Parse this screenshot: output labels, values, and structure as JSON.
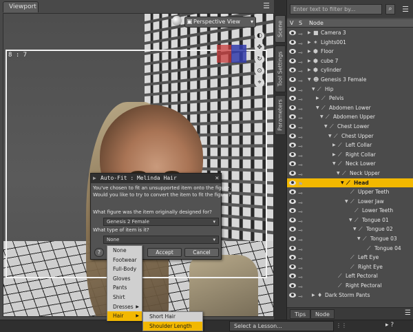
{
  "viewport": {
    "tab_label": "Viewport",
    "view_select": "Perspective View",
    "aspect_label": "8 : 7"
  },
  "side_tabs": [
    "Scene",
    "Tool Settings",
    "Parameters"
  ],
  "scene_pane": {
    "filter_placeholder": "Enter text to filter by...",
    "columns": {
      "visible": "V",
      "selectable": "S",
      "node": "Node"
    },
    "nodes": [
      {
        "label": "Camera 3",
        "depth": 0,
        "icon": "camera-icon"
      },
      {
        "label": "Lights001",
        "depth": 0,
        "icon": "lights-icon"
      },
      {
        "label": "Floor",
        "depth": 0,
        "icon": "prop-icon"
      },
      {
        "label": "cube 7",
        "depth": 0,
        "icon": "prop-icon"
      },
      {
        "label": "cylinder",
        "depth": 0,
        "icon": "prop-icon"
      },
      {
        "label": "Genesis 3 Female",
        "depth": 0,
        "icon": "figure-icon"
      },
      {
        "label": "Hip",
        "depth": 1,
        "icon": "bone-icon"
      },
      {
        "label": "Pelvis",
        "depth": 2,
        "icon": "bone-icon"
      },
      {
        "label": "Abdomen Lower",
        "depth": 2,
        "icon": "bone-icon"
      },
      {
        "label": "Abdomen Upper",
        "depth": 3,
        "icon": "bone-icon"
      },
      {
        "label": "Chest Lower",
        "depth": 4,
        "icon": "bone-icon"
      },
      {
        "label": "Chest Upper",
        "depth": 5,
        "icon": "bone-icon"
      },
      {
        "label": "Left Collar",
        "depth": 6,
        "icon": "bone-icon"
      },
      {
        "label": "Right Collar",
        "depth": 6,
        "icon": "bone-icon"
      },
      {
        "label": "Neck Lower",
        "depth": 6,
        "icon": "bone-icon"
      },
      {
        "label": "Neck Upper",
        "depth": 7,
        "icon": "bone-icon"
      },
      {
        "label": "Head",
        "depth": 8,
        "icon": "bone-icon",
        "selected": true
      },
      {
        "label": "Upper Teeth",
        "depth": 9,
        "icon": "bone-icon"
      },
      {
        "label": "Lower Jaw",
        "depth": 9,
        "icon": "bone-icon"
      },
      {
        "label": "Lower Teeth",
        "depth": 10,
        "icon": "bone-icon"
      },
      {
        "label": "Tongue 01",
        "depth": 10,
        "icon": "bone-icon"
      },
      {
        "label": "Tongue 02",
        "depth": 11,
        "icon": "bone-icon"
      },
      {
        "label": "Tongue 03",
        "depth": 12,
        "icon": "bone-icon"
      },
      {
        "label": "Tongue 04",
        "depth": 13,
        "icon": "bone-icon"
      },
      {
        "label": "Left Eye",
        "depth": 9,
        "icon": "bone-icon"
      },
      {
        "label": "Right Eye",
        "depth": 9,
        "icon": "bone-icon"
      },
      {
        "label": "Left Pectoral",
        "depth": 6,
        "icon": "bone-icon"
      },
      {
        "label": "Right Pectoral",
        "depth": 6,
        "icon": "bone-icon"
      },
      {
        "label": "Dark Storm Pants",
        "depth": 1,
        "icon": "clothing-icon"
      }
    ],
    "footer_tabs": [
      "Tips",
      "Node"
    ]
  },
  "dialog": {
    "title": "Auto-Fit : Melinda Hair",
    "message_line1": "You've chosen to fit an unsupported item onto the figure.",
    "message_line2": "Would you like to try to convert the item to fit the figure?",
    "question1": "What figure was the item originally designed for?",
    "figure_value": "Genesis 2 Female",
    "question2": "What type of item is it?",
    "type_value": "None",
    "accept_label": "Accept",
    "cancel_label": "Cancel",
    "help_label": "?"
  },
  "type_menu": {
    "items": [
      "None",
      "Footwear",
      "Full-Body",
      "Gloves",
      "Pants",
      "Shirt",
      "Dresses",
      "Hair"
    ],
    "active": "Hair"
  },
  "hair_submenu": {
    "items": [
      "Short Hair",
      "Shoulder Length Hair"
    ],
    "active": "Shoulder Length Hair"
  },
  "status_bar": {
    "lesson_placeholder": "Select a Lesson..."
  },
  "colors": {
    "selection": "#f2b800",
    "panel_bg": "#4b4b4b",
    "menu_bg": "#d0d0d0"
  }
}
